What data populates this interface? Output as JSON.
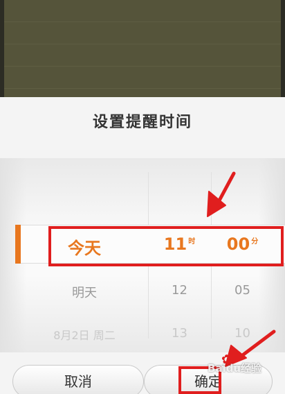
{
  "dialog": {
    "title": "设置提醒时间"
  },
  "picker": {
    "day_column": [
      "今天",
      "明天",
      "8月2日 周二"
    ],
    "hour_column": [
      "11",
      "12",
      "13"
    ],
    "minute_column": [
      "00",
      "05",
      "10"
    ],
    "hour_unit": "时",
    "minute_unit": "分",
    "selected": {
      "day": "今天",
      "hour": "11",
      "minute": "00"
    }
  },
  "buttons": {
    "cancel": "取消",
    "confirm": "确定"
  },
  "colors": {
    "accent": "#e8771f",
    "annotation": "#e01e1e"
  },
  "watermark": "Baidu经验"
}
